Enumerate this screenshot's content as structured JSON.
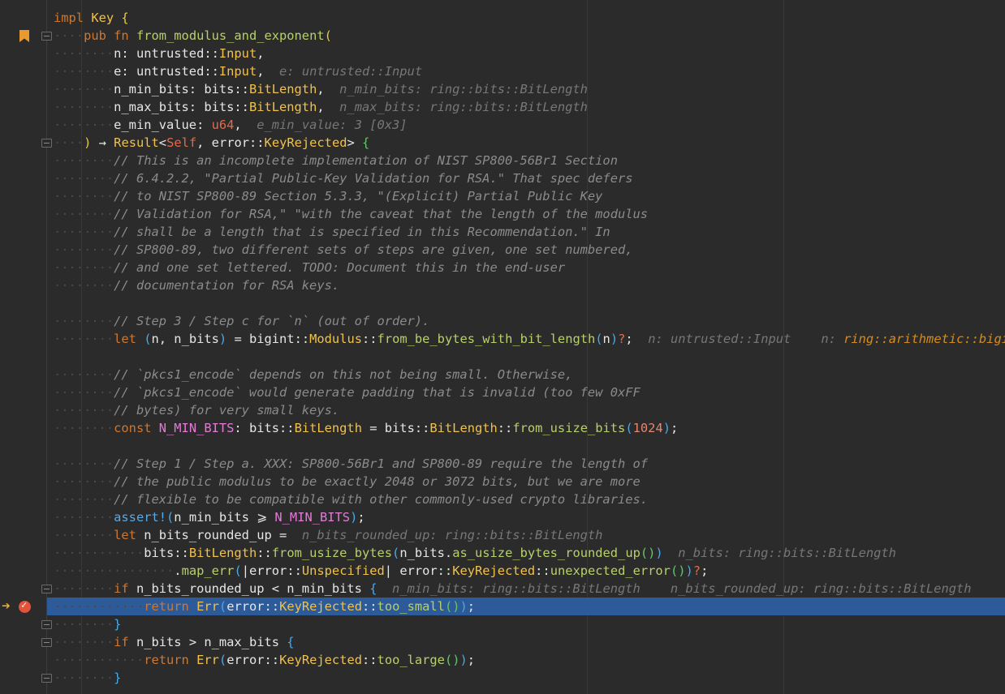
{
  "editor": {
    "lines": [
      [
        [
          "kw",
          "impl "
        ],
        [
          "ty",
          "Key "
        ],
        [
          "p1",
          "{"
        ]
      ],
      [
        [
          "dot",
          "····"
        ],
        [
          "kw",
          "pub fn "
        ],
        [
          "fn",
          "from_modulus_and_exponent"
        ],
        [
          "p1",
          "("
        ]
      ],
      [
        [
          "dot",
          "········"
        ],
        [
          "ns",
          "n: untrusted::"
        ],
        [
          "ty",
          "Input"
        ],
        [
          "ns",
          ","
        ]
      ],
      [
        [
          "dot",
          "········"
        ],
        [
          "ns",
          "e: untrusted::"
        ],
        [
          "ty",
          "Input"
        ],
        [
          "ns",
          ",  "
        ],
        [
          "hint",
          "e: untrusted::Input"
        ]
      ],
      [
        [
          "dot",
          "········"
        ],
        [
          "ns",
          "n_min_bits: bits::"
        ],
        [
          "ty",
          "BitLength"
        ],
        [
          "ns",
          ",  "
        ],
        [
          "hint",
          "n_min_bits: ring::bits::BitLength"
        ]
      ],
      [
        [
          "dot",
          "········"
        ],
        [
          "ns",
          "n_max_bits: bits::"
        ],
        [
          "ty",
          "BitLength"
        ],
        [
          "ns",
          ",  "
        ],
        [
          "hint",
          "n_max_bits: ring::bits::BitLength"
        ]
      ],
      [
        [
          "dot",
          "········"
        ],
        [
          "ns",
          "e_min_value: "
        ],
        [
          "kwr",
          "u64"
        ],
        [
          "ns",
          ",  "
        ],
        [
          "hint",
          "e_min_value: 3 [0x3]"
        ]
      ],
      [
        [
          "dot",
          "····"
        ],
        [
          "p1",
          ")"
        ],
        [
          "ns",
          " → "
        ],
        [
          "ty",
          "Result"
        ],
        [
          "ns",
          "<"
        ],
        [
          "kwr",
          "Self"
        ],
        [
          "ns",
          ", error::"
        ],
        [
          "ty",
          "KeyRejected"
        ],
        [
          "ns",
          "> "
        ],
        [
          "p3",
          "{"
        ]
      ],
      [
        [
          "dot",
          "········"
        ],
        [
          "cm",
          "// This is an incomplete implementation of NIST SP800-56Br1 Section"
        ]
      ],
      [
        [
          "dot",
          "········"
        ],
        [
          "cm",
          "// 6.4.2.2, \"Partial Public-Key Validation for RSA.\" That spec defers"
        ]
      ],
      [
        [
          "dot",
          "········"
        ],
        [
          "cm",
          "// to NIST SP800-89 Section 5.3.3, \"(Explicit) Partial Public Key"
        ]
      ],
      [
        [
          "dot",
          "········"
        ],
        [
          "cm",
          "// Validation for RSA,\" \"with the caveat that the length of the modulus"
        ]
      ],
      [
        [
          "dot",
          "········"
        ],
        [
          "cm",
          "// shall be a length that is specified in this Recommendation.\" In"
        ]
      ],
      [
        [
          "dot",
          "········"
        ],
        [
          "cm",
          "// SP800-89, two different sets of steps are given, one set numbered,"
        ]
      ],
      [
        [
          "dot",
          "········"
        ],
        [
          "cm",
          "// and one set lettered. TODO: Document this in the end-user"
        ]
      ],
      [
        [
          "dot",
          "········"
        ],
        [
          "cm",
          "// documentation for RSA keys."
        ]
      ],
      [],
      [
        [
          "dot",
          "········"
        ],
        [
          "cm",
          "// Step 3 / Step c for `n` (out of order)."
        ]
      ],
      [
        [
          "dot",
          "········"
        ],
        [
          "kw",
          "let "
        ],
        [
          "p2",
          "("
        ],
        [
          "ns",
          "n, n_bits"
        ],
        [
          "p2",
          ")"
        ],
        [
          "ns",
          " = bigint::"
        ],
        [
          "ty",
          "Modulus"
        ],
        [
          "ns",
          "::"
        ],
        [
          "fn",
          "from_be_bytes_with_bit_length"
        ],
        [
          "p2",
          "("
        ],
        [
          "ns",
          "n"
        ],
        [
          "p2",
          ")"
        ],
        [
          "err",
          "?"
        ],
        [
          "ns",
          ";  "
        ],
        [
          "hint",
          "n: untrusted::Input    n: "
        ],
        [
          "hint-o",
          "ring::arithmetic::bigint::"
        ]
      ],
      [],
      [
        [
          "dot",
          "········"
        ],
        [
          "cm",
          "// `pkcs1_encode` depends on this not being small. Otherwise,"
        ]
      ],
      [
        [
          "dot",
          "········"
        ],
        [
          "cm",
          "// `pkcs1_encode` would generate padding that is invalid (too few 0xFF"
        ]
      ],
      [
        [
          "dot",
          "········"
        ],
        [
          "cm",
          "// bytes) for very small keys."
        ]
      ],
      [
        [
          "dot",
          "········"
        ],
        [
          "kw",
          "const "
        ],
        [
          "cst",
          "N_MIN_BITS"
        ],
        [
          "ns",
          ": bits::"
        ],
        [
          "ty",
          "BitLength"
        ],
        [
          "ns",
          " = bits::"
        ],
        [
          "ty",
          "BitLength"
        ],
        [
          "ns",
          "::"
        ],
        [
          "fn",
          "from_usize_bits"
        ],
        [
          "p2",
          "("
        ],
        [
          "num",
          "1024"
        ],
        [
          "p2",
          ")"
        ],
        [
          "ns",
          ";"
        ]
      ],
      [],
      [
        [
          "dot",
          "········"
        ],
        [
          "cm",
          "// Step 1 / Step a. XXX: SP800-56Br1 and SP800-89 require the length of"
        ]
      ],
      [
        [
          "dot",
          "········"
        ],
        [
          "cm",
          "// the public modulus to be exactly 2048 or 3072 bits, but we are more"
        ]
      ],
      [
        [
          "dot",
          "········"
        ],
        [
          "cm",
          "// flexible to be compatible with other commonly-used crypto libraries."
        ]
      ],
      [
        [
          "dot",
          "········"
        ],
        [
          "mac",
          "assert!"
        ],
        [
          "p2",
          "("
        ],
        [
          "ns",
          "n_min_bits ⩾ "
        ],
        [
          "cst",
          "N_MIN_BITS"
        ],
        [
          "p2",
          ")"
        ],
        [
          "ns",
          ";"
        ]
      ],
      [
        [
          "dot",
          "········"
        ],
        [
          "kw",
          "let "
        ],
        [
          "ns",
          "n_bits_rounded_up =  "
        ],
        [
          "hint",
          "n_bits_rounded_up: ring::bits::BitLength"
        ]
      ],
      [
        [
          "dot",
          "········"
        ],
        [
          "dot",
          "····"
        ],
        [
          "ns",
          "bits::"
        ],
        [
          "ty",
          "BitLength"
        ],
        [
          "ns",
          "::"
        ],
        [
          "fn",
          "from_usize_bytes"
        ],
        [
          "p2",
          "("
        ],
        [
          "ns",
          "n_bits."
        ],
        [
          "fn",
          "as_usize_bytes_rounded_up"
        ],
        [
          "p3",
          "()"
        ],
        [
          "p2",
          ")"
        ],
        [
          "ns",
          "  "
        ],
        [
          "hint",
          "n_bits: ring::bits::BitLength"
        ]
      ],
      [
        [
          "dot",
          "········"
        ],
        [
          "dot",
          "········"
        ],
        [
          "ns",
          "."
        ],
        [
          "fn",
          "map_err"
        ],
        [
          "p2",
          "("
        ],
        [
          "ns",
          "|error::"
        ],
        [
          "ty",
          "Unspecified"
        ],
        [
          "ns",
          "| error::"
        ],
        [
          "ty",
          "KeyRejected"
        ],
        [
          "ns",
          "::"
        ],
        [
          "fn",
          "unexpected_error"
        ],
        [
          "p3",
          "()"
        ],
        [
          "p2",
          ")"
        ],
        [
          "err",
          "?"
        ],
        [
          "ns",
          ";"
        ]
      ],
      [
        [
          "dot",
          "········"
        ],
        [
          "kw",
          "if "
        ],
        [
          "ns",
          "n_bits_rounded_up < n_min_bits "
        ],
        [
          "p2",
          "{"
        ],
        [
          "ns",
          "  "
        ],
        [
          "hint",
          "n_min_bits: ring::bits::BitLength    n_bits_rounded_up: ring::bits::BitLength"
        ]
      ],
      [
        [
          "dot",
          "········"
        ],
        [
          "dot",
          "····"
        ],
        [
          "kw",
          "return "
        ],
        [
          "ty",
          "Err"
        ],
        [
          "p2",
          "("
        ],
        [
          "ns",
          "error::"
        ],
        [
          "ty",
          "KeyRejected"
        ],
        [
          "ns",
          "::"
        ],
        [
          "fn",
          "too_small"
        ],
        [
          "p3",
          "()"
        ],
        [
          "p2",
          ")"
        ],
        [
          "ns",
          ";"
        ]
      ],
      [
        [
          "dot",
          "········"
        ],
        [
          "p2",
          "}"
        ]
      ],
      [
        [
          "dot",
          "········"
        ],
        [
          "kw",
          "if "
        ],
        [
          "ns",
          "n_bits > n_max_bits "
        ],
        [
          "p2",
          "{"
        ]
      ],
      [
        [
          "dot",
          "········"
        ],
        [
          "dot",
          "····"
        ],
        [
          "kw",
          "return "
        ],
        [
          "ty",
          "Err"
        ],
        [
          "p2",
          "("
        ],
        [
          "ns",
          "error::"
        ],
        [
          "ty",
          "KeyRejected"
        ],
        [
          "ns",
          "::"
        ],
        [
          "fn",
          "too_large"
        ],
        [
          "p3",
          "()"
        ],
        [
          "p2",
          ")"
        ],
        [
          "ns",
          ";"
        ]
      ],
      [
        [
          "dot",
          "········"
        ],
        [
          "p2",
          "}"
        ]
      ]
    ],
    "current_line": 33,
    "fold_lines": [
      1,
      7,
      32,
      34,
      35,
      37
    ]
  },
  "gutter": {
    "bookmark_icon": "bookmark-icon",
    "execution_arrow": "➔",
    "breakpoint_icon": "breakpoint-icon"
  },
  "colors": {
    "background": "#2b2b2b",
    "current_line": "#2d5b99",
    "keyword": "#cc7832",
    "function": "#b8d06a",
    "type": "#f0c14b",
    "comment": "#8b8b8b"
  }
}
